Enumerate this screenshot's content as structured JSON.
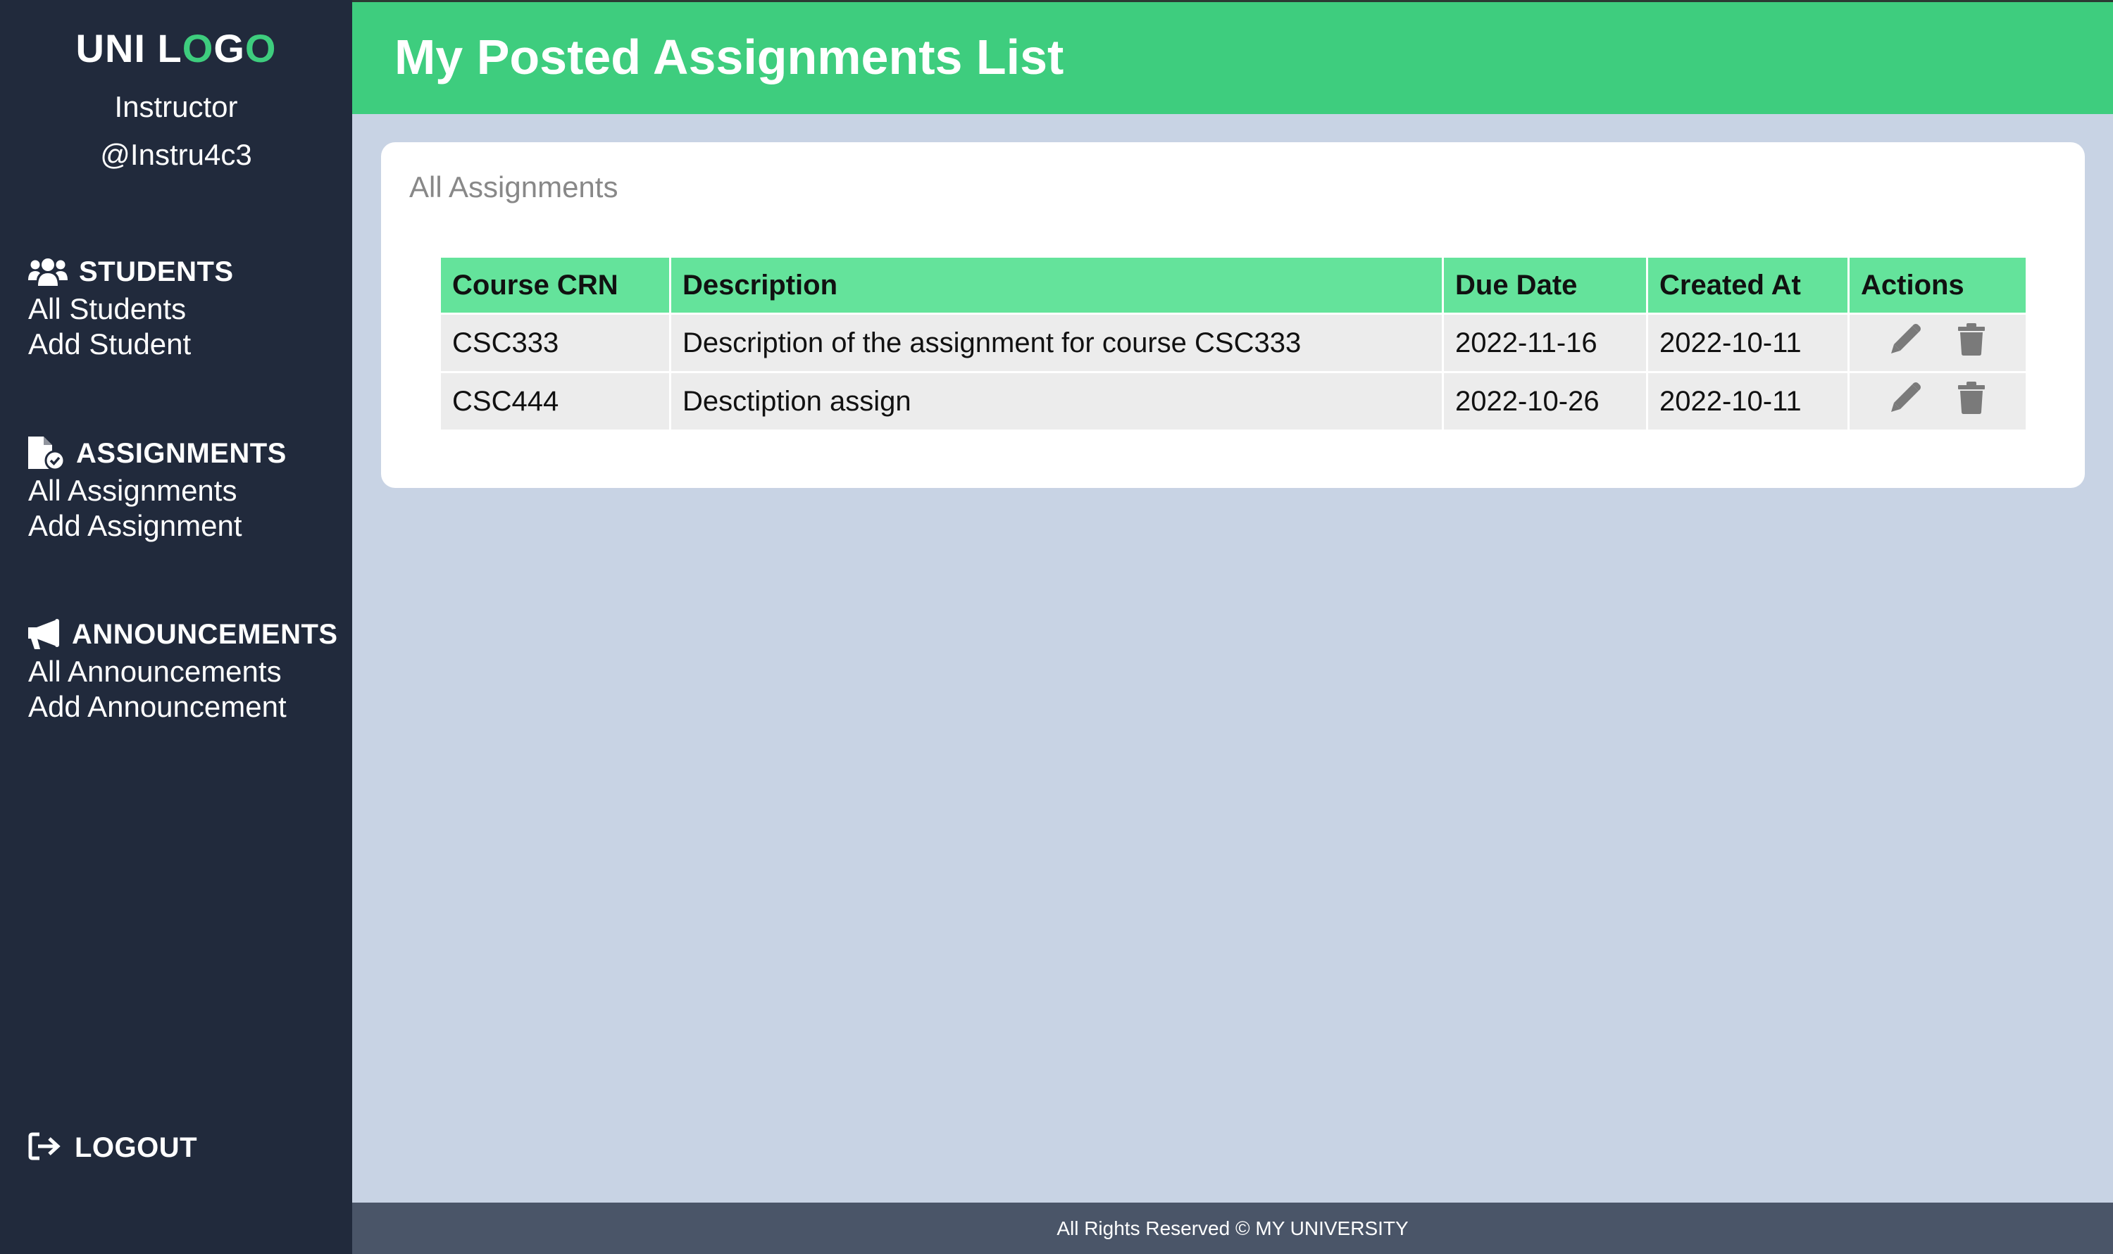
{
  "sidebar": {
    "logo": {
      "prefix": "UNI L",
      "o1": "O",
      "mid": "G",
      "o2": "O"
    },
    "role": "Instructor",
    "handle": "@Instru4c3",
    "sections": [
      {
        "title": "STUDENTS",
        "icon": "users-icon",
        "links": [
          "All Students",
          "Add Student"
        ]
      },
      {
        "title": "ASSIGNMENTS",
        "icon": "file-check-icon",
        "links": [
          "All Assignments",
          "Add Assignment"
        ]
      },
      {
        "title": "ANNOUNCEMENTS",
        "icon": "megaphone-icon",
        "links": [
          "All Announcements",
          "Add Announcement"
        ]
      }
    ],
    "logout": "LOGOUT"
  },
  "header": {
    "title": "My Posted Assignments List"
  },
  "card": {
    "title": "All Assignments",
    "columns": [
      "Course CRN",
      "Description",
      "Due Date",
      "Created At",
      "Actions"
    ],
    "rows": [
      {
        "crn": "CSC333",
        "description": "Description of the assignment for course CSC333",
        "due": "2022-11-16",
        "created": "2022-10-11"
      },
      {
        "crn": "CSC444",
        "description": "Desctiption assign",
        "due": "2022-10-26",
        "created": "2022-10-11"
      }
    ],
    "action_icons": [
      "pencil-icon",
      "trash-icon"
    ]
  },
  "footer": {
    "text": "All Rights Reserved © MY UNIVERSITY"
  },
  "colors": {
    "accent": "#3ecd7e",
    "sidebar": "#212a3c",
    "background": "#c8d3e4",
    "table_header": "#64e39b",
    "footer": "#4a5568"
  }
}
